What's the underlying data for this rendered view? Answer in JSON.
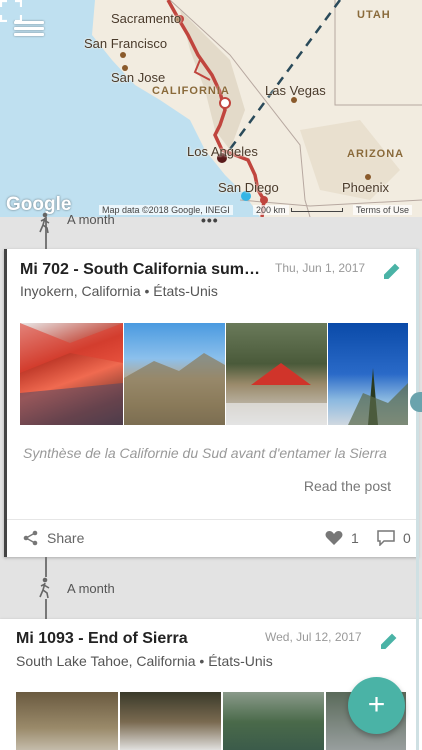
{
  "map": {
    "google_label": "Google",
    "attribution": "Map data ©2018 Google, INEGI",
    "scale_label": "200 km",
    "terms": "Terms of Use",
    "cities": {
      "sacramento": "Sacramento",
      "san_francisco": "San Francisco",
      "san_jose": "San Jose",
      "las_vegas": "Las Vegas",
      "los_angeles": "Los Angeles",
      "san_diego": "San Diego",
      "phoenix": "Phoenix"
    },
    "states": {
      "utah": "UTAH",
      "california": "CALIFORNIA",
      "arizona": "ARIZONA"
    },
    "colors": {
      "route": "#c0453e",
      "dashed_line": "#2a4a5a",
      "land": "#f2ece0",
      "water": "#bfe0f0"
    }
  },
  "timeline": {
    "top_label": "A month",
    "middle_label": "A month"
  },
  "posts": [
    {
      "title": "Mi 702 - South California summ...",
      "date": "Thu, Jun 1, 2017",
      "location": "Inyokern, California • États-Unis",
      "summary": "Synthèse de la Californie du Sud avant d'entamer la Sierra",
      "read_label": "Read the post",
      "share_label": "Share",
      "likes": "1",
      "comments": "0",
      "photo_count": 7,
      "active_photo_index": 0
    },
    {
      "title": "Mi 1093 - End of Sierra",
      "date": "Wed, Jul 12, 2017",
      "location": "South Lake Tahoe, California • États-Unis"
    }
  ],
  "fab_label": "+",
  "accent_color": "#4ab3a6"
}
